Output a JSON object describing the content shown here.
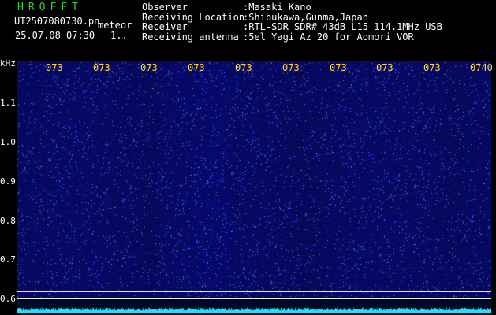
{
  "header": {
    "logo": "HROFFT",
    "filename": "UT2507080730.pn",
    "tag": "meteor",
    "datetime": "25.07.08 07:30",
    "count": "1..",
    "info": [
      {
        "key": "Observer",
        "value": ":Masaki Kano"
      },
      {
        "key": "Receiving Location",
        "value": ":Shibukawa,Gunma,Japan"
      },
      {
        "key": "Receiver",
        "value": ":RTL-SDR SDR# 43dB L15 114.1MHz USB"
      },
      {
        "key": "Receiving antenna",
        "value": ":5el Yagi Az 20 for Aomori VOR"
      }
    ]
  },
  "axes": {
    "unit": "kHz",
    "y_ticks": [
      "1.1",
      "1.0",
      "0.9",
      "0.8",
      "0.7",
      "0.6"
    ],
    "x_ticks": [
      "073",
      "073",
      "073",
      "073",
      "073",
      "073",
      "073",
      "073",
      "073",
      "0740"
    ]
  },
  "colors": {
    "background": "#000000",
    "waterfall": "#0a0f6e",
    "logo": "#2ed03a",
    "time_labels": "#ffd83a",
    "baseline": "#22e0ff"
  }
}
